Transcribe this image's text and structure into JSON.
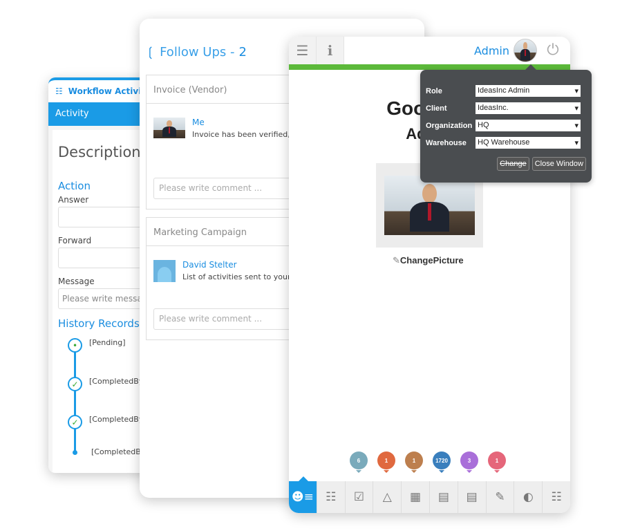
{
  "workflow": {
    "title": "Workflow Activities",
    "tab": "Activity",
    "description": "Description",
    "action_heading": "Action",
    "answer_label": "Answer",
    "forward_label": "Forward",
    "message_label": "Message",
    "message_placeholder": "Please write message",
    "history_heading": "History Records",
    "history": [
      {
        "text": "[Pending]",
        "status": "pending"
      },
      {
        "text": "[CompletedBy]",
        "status": "completed"
      },
      {
        "text": "[CompletedBy]",
        "status": "completed"
      },
      {
        "text": "[CompletedBy]",
        "status": "point"
      }
    ]
  },
  "followups": {
    "title": "Follow Ups - ",
    "count": "2",
    "items": [
      {
        "heading": "Invoice (Vendor)",
        "author": "Me",
        "text": "Invoice has been verified,",
        "comment_placeholder": "Please write comment ..."
      },
      {
        "heading": "Marketing Campaign",
        "author": "David Stelter",
        "text": "List of activities sent to your",
        "comment_placeholder": "Please write comment ..."
      }
    ]
  },
  "main": {
    "user": "Admin",
    "greeting": "GoodDay",
    "greeting_sub": "Admin",
    "change_picture": "ChangePicture",
    "accent": "#1a9be6",
    "progress_color": "#5cb93a",
    "badges": [
      {
        "value": "6",
        "color": "#7aaabb"
      },
      {
        "value": "1",
        "color": "#e0693f"
      },
      {
        "value": "1",
        "color": "#bd7f4e"
      },
      {
        "value": "1720",
        "color": "#3a7fbd"
      },
      {
        "value": "3",
        "color": "#a96fd9"
      },
      {
        "value": "1",
        "color": "#e5667a"
      }
    ],
    "nav": [
      "contact-card-icon",
      "org-chart-icon",
      "clipboard-check-icon",
      "alarm-bell-icon",
      "calendar-icon",
      "list-import-icon",
      "list-export-icon",
      "notebook-icon",
      "gauge-icon",
      "document-settings-icon"
    ]
  },
  "popup": {
    "fields": [
      {
        "label": "Role",
        "value": "IdeasInc Admin"
      },
      {
        "label": "Client",
        "value": "IdeasInc."
      },
      {
        "label": "Organization",
        "value": "HQ"
      },
      {
        "label": "Warehouse",
        "value": "HQ Warehouse"
      }
    ],
    "change": "Change",
    "close": "Close Window"
  }
}
